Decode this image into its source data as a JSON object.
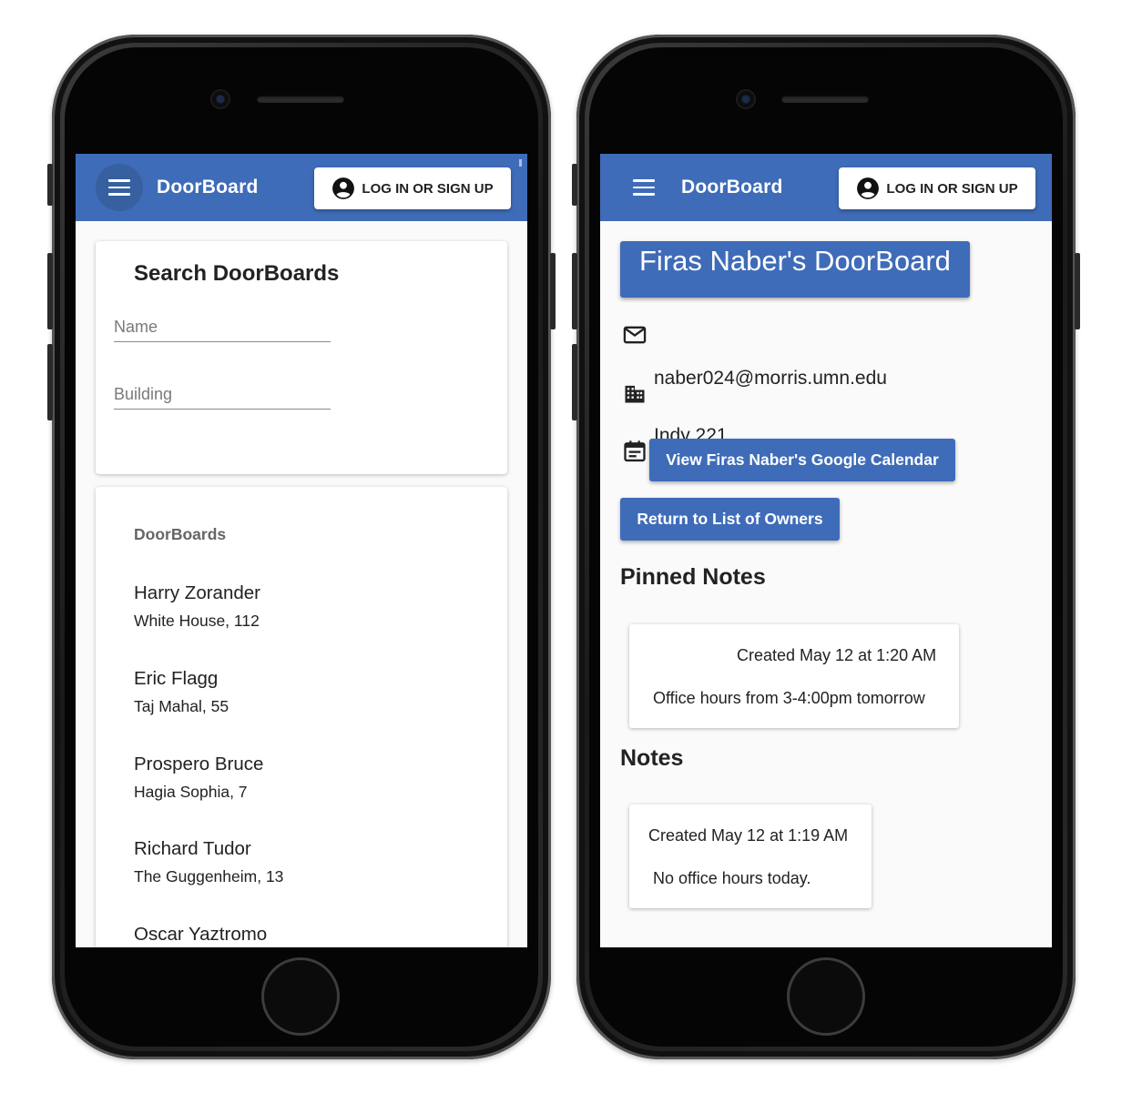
{
  "left_screen": {
    "toolbar": {
      "title": "DoorBoard",
      "login_label": "LOG IN OR SIGN UP"
    },
    "search": {
      "title": "Search DoorBoards",
      "name_placeholder": "Name",
      "building_placeholder": "Building"
    },
    "list": {
      "header": "DoorBoards",
      "owners": [
        {
          "name": "Harry Zorander",
          "location": "White House, 112"
        },
        {
          "name": "Eric Flagg",
          "location": "Taj Mahal, 55"
        },
        {
          "name": "Prospero Bruce",
          "location": "Hagia Sophia, 7"
        },
        {
          "name": "Richard Tudor",
          "location": "The Guggenheim, 13"
        },
        {
          "name": "Oscar Yaztromo",
          "location": ""
        }
      ]
    }
  },
  "right_screen": {
    "toolbar": {
      "title": "DoorBoard",
      "login_label": "LOG IN OR SIGN UP"
    },
    "board_title": "Firas Naber's DoorBoard",
    "email": "naber024@morris.umn.edu",
    "office": "Indy 221",
    "calendar_button": "View Firas Naber's Google Calendar",
    "return_button": "Return to List of Owners",
    "pinned_title": "Pinned Notes",
    "pinned_notes": [
      {
        "date": "Created May 12 at 1:20 AM",
        "body": "Office hours from 3-4:00pm tomorrow"
      }
    ],
    "notes_title": "Notes",
    "notes": [
      {
        "date": "Created May 12 at 1:19 AM",
        "body": "No office hours today."
      }
    ]
  },
  "icons": {
    "menu": "menu-icon",
    "account": "account-circle-icon",
    "email": "email-icon",
    "building": "building-icon",
    "calendar": "calendar-icon"
  },
  "colors": {
    "primary": "#3f6cb8",
    "primary_dark": "#36609f",
    "background": "#fafafa",
    "card": "#ffffff",
    "text": "#222222"
  }
}
